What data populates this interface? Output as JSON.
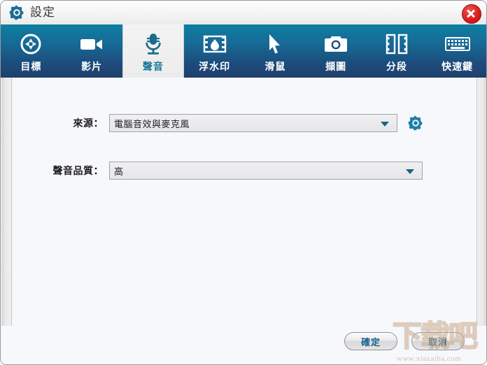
{
  "window": {
    "title": "設定",
    "title_icon": "gear-icon",
    "close_icon": "close-icon"
  },
  "toolbar": {
    "active_tab": "聲音",
    "tabs": [
      {
        "label": "目標",
        "icon": "target-icon",
        "active": false
      },
      {
        "label": "影片",
        "icon": "video-camera-icon",
        "active": false
      },
      {
        "label": "聲音",
        "icon": "microphone-icon",
        "active": true
      },
      {
        "label": "浮水印",
        "icon": "watermark-icon",
        "active": false
      },
      {
        "label": "滑鼠",
        "icon": "cursor-icon",
        "active": false
      },
      {
        "label": "擷圖",
        "icon": "camera-icon",
        "active": false
      },
      {
        "label": "分段",
        "icon": "film-strip-icon",
        "active": false
      },
      {
        "label": "快速鍵",
        "icon": "keyboard-icon",
        "active": false
      }
    ]
  },
  "form": {
    "source": {
      "label": "來源：",
      "value": "電腦音效與麥克風",
      "settings_icon": "gear-icon"
    },
    "quality": {
      "label": "聲音品質：",
      "value": "高"
    }
  },
  "footer": {
    "ok_label": "確定",
    "cancel_label": "取消"
  },
  "watermark": {
    "text": "下载吧",
    "url": "www.xiazaiba.com"
  },
  "colors": {
    "toolbar_top": "#0e7fa2",
    "toolbar_bottom": "#203f6b",
    "accent_teal": "#16799c",
    "close_red": "#dc1f1f",
    "content_bg": "#f7f8fc"
  }
}
